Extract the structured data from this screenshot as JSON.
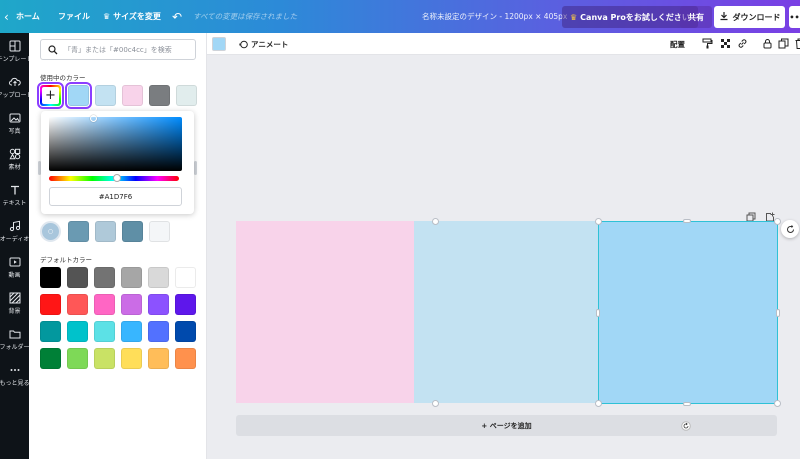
{
  "topbar": {
    "home_label": "ホーム",
    "file_label": "ファイル",
    "resize_label": "サイズを変更",
    "saved_status": "すべての変更は保存されました",
    "doc_name": "名称未設定のデザイン - 1200px × 405px",
    "pro_trial_label": "Canva Proをお試しください",
    "share_label": "共有",
    "download_label": "ダウンロード",
    "more_label": "•••"
  },
  "rail": {
    "items": [
      {
        "label": "テンプレート",
        "icon": "template-icon"
      },
      {
        "label": "アップロード",
        "icon": "upload-cloud-icon"
      },
      {
        "label": "写真",
        "icon": "photo-icon"
      },
      {
        "label": "素材",
        "icon": "elements-icon"
      },
      {
        "label": "テキスト",
        "icon": "text-icon"
      },
      {
        "label": "オーディオ",
        "icon": "music-note-icon"
      },
      {
        "label": "動画",
        "icon": "video-icon"
      },
      {
        "label": "背景",
        "icon": "background-icon"
      },
      {
        "label": "フォルダー",
        "icon": "folder-icon"
      },
      {
        "label": "もっと見る",
        "icon": "more-dots-icon"
      }
    ]
  },
  "panel": {
    "search_placeholder": "「青」または「#00c4cc」を検索",
    "in_use_title": "使用中のカラー",
    "in_use_colors": [
      "#a1d7f6",
      "#c3e2f2",
      "#f8d3ea",
      "#7a7d80",
      "#e1eded"
    ],
    "selected_color_index": 0,
    "hex_value": "#A1D7F6",
    "photo_colors": [
      "#6a9ab2",
      "#afc9d9",
      "#5f8fa6",
      "#f4f6f8"
    ],
    "default_title": "デフォルトカラー",
    "default_colors": [
      "#000000",
      "#545454",
      "#737373",
      "#a6a6a6",
      "#d9d9d9",
      "#ffffff",
      "#ff1616",
      "#ff5757",
      "#ff66c4",
      "#cb6ce6",
      "#8c52ff",
      "#5e17eb",
      "#03989e",
      "#00c2cb",
      "#5ce1e6",
      "#38b6ff",
      "#5271ff",
      "#004aad",
      "#008037",
      "#7ed957",
      "#c9e265",
      "#ffde59",
      "#ffbd59",
      "#ff914d"
    ]
  },
  "editor": {
    "animate_label": "アニメート",
    "position_label": "配置",
    "fill_color": "#a1d7f6"
  },
  "canvas": {
    "cells": [
      "#f8d3ea",
      "#c3e2f2",
      "#a1d7f6"
    ],
    "add_page_label": "+ ページを追加"
  }
}
